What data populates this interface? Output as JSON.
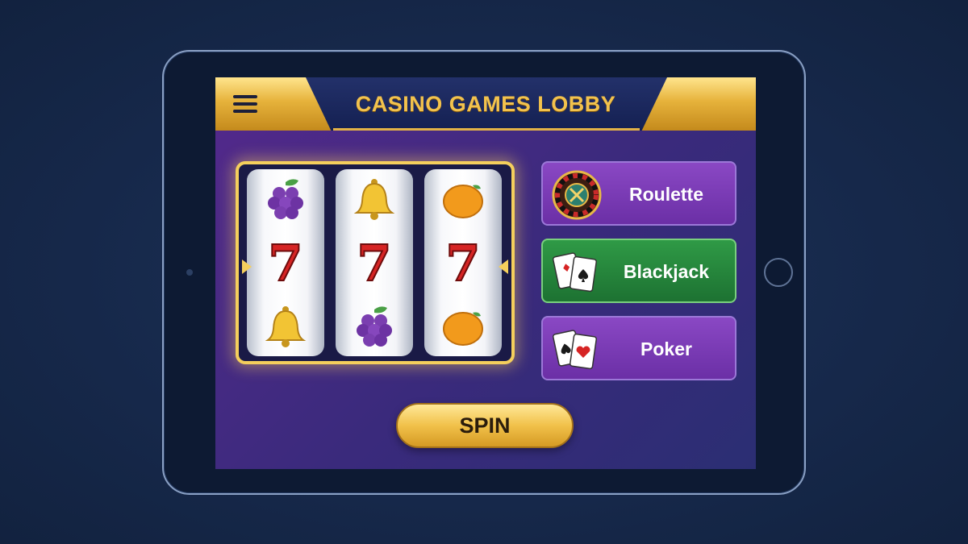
{
  "header": {
    "title": "CASINO GAMES LOBBY",
    "menu_icon": "hamburger-menu-icon"
  },
  "slot_machine": {
    "reels": [
      [
        "grapes",
        "seven",
        "bell"
      ],
      [
        "bell",
        "seven",
        "grapes"
      ],
      [
        "orange",
        "seven",
        "orange"
      ]
    ],
    "seven_glyph": "7"
  },
  "games": [
    {
      "label": "Roulette",
      "icon": "roulette-wheel-icon",
      "color": "#7a3bb6"
    },
    {
      "label": "Blackjack",
      "icon": "playing-cards-icon",
      "color": "#268a3f"
    },
    {
      "label": "Poker",
      "icon": "playing-cards-icon",
      "color": "#7a3bb6"
    }
  ],
  "spin": {
    "label": "SPIN"
  },
  "colors": {
    "accent_gold": "#f2c24d",
    "screen_purple": "#54298c",
    "frame": "#0d1a33"
  }
}
